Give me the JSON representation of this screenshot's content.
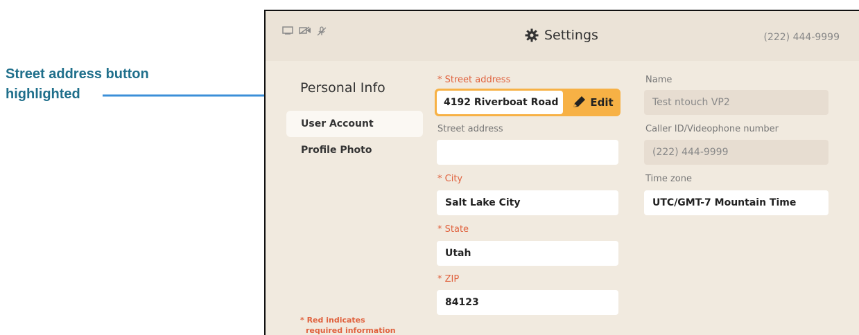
{
  "callout": {
    "text_line1": "Street address button",
    "text_line2": "highlighted"
  },
  "topbar": {
    "title": "Settings",
    "phone": "(222) 444-9999",
    "status_icons": [
      "screen-icon",
      "camera-off-icon",
      "mic-off-icon"
    ]
  },
  "sidebar": {
    "title": "Personal Info",
    "items": [
      {
        "label": "User Account",
        "active": true
      },
      {
        "label": "Profile Photo",
        "active": false
      }
    ],
    "required_note_line1": "* Red indicates",
    "required_note_line2": "required information"
  },
  "form": {
    "street1_label": "* Street address",
    "street1_value": "4192 Riverboat Road",
    "edit_label": "Edit",
    "street2_label": "Street address",
    "street2_value": "",
    "city_label": "* City",
    "city_value": "Salt Lake City",
    "state_label": "* State",
    "state_value": "Utah",
    "zip_label": "* ZIP",
    "zip_value": "84123",
    "name_label": "Name",
    "name_value": "Test ntouch VP2",
    "callerid_label": "Caller ID/Videophone number",
    "callerid_value": "(222) 444-9999",
    "timezone_label": "Time zone",
    "timezone_value": "UTC/GMT-7 Mountain Time"
  },
  "colors": {
    "callout_text": "#1f6f8b",
    "arrow": "#3b8fd8",
    "highlight": "#f7b145",
    "required": "#e0623e",
    "background": "#f1eadf"
  }
}
